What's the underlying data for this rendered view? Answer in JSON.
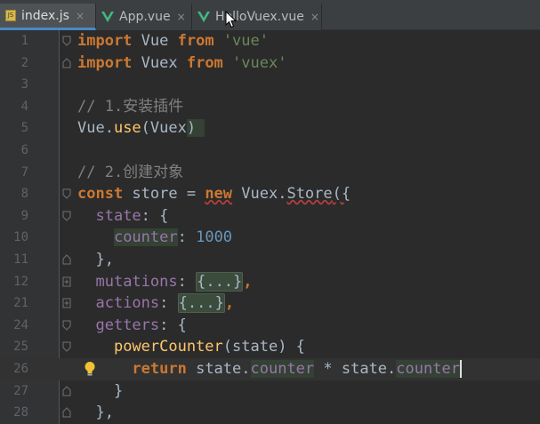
{
  "tabs": [
    {
      "label": "index.js",
      "icon": "js-file-icon",
      "active": true
    },
    {
      "label": "App.vue",
      "icon": "vue-file-icon",
      "active": false
    },
    {
      "label": "HelloVuex.vue",
      "icon": "vue-file-icon",
      "active": false
    }
  ],
  "close_glyph": "×",
  "lines": [
    {
      "n": "1"
    },
    {
      "n": "2"
    },
    {
      "n": "3"
    },
    {
      "n": "4"
    },
    {
      "n": "5"
    },
    {
      "n": "6"
    },
    {
      "n": "7"
    },
    {
      "n": "8"
    },
    {
      "n": "9"
    },
    {
      "n": "10"
    },
    {
      "n": "11"
    },
    {
      "n": "12"
    },
    {
      "n": "21"
    },
    {
      "n": "24"
    },
    {
      "n": "25"
    },
    {
      "n": "26"
    },
    {
      "n": "27"
    },
    {
      "n": "28"
    }
  ],
  "code": {
    "l1": {
      "kw1": "import",
      "id": " Vue ",
      "kw2": "from",
      "sp": " ",
      "str": "'vue'"
    },
    "l2": {
      "kw1": "import",
      "id": " Vuex ",
      "kw2": "from",
      "sp": " ",
      "str": "'vuex'"
    },
    "l4": {
      "comment": "// 1.安装插件"
    },
    "l5": {
      "a": "Vue.",
      "fn": "use",
      "b": "(Vuex",
      "c": ")"
    },
    "l7": {
      "comment": "// 2.创建对象"
    },
    "l8": {
      "kw1": "const",
      "a": " store = ",
      "kw2": "new",
      "b": " Vuex.",
      "cls": "Store",
      "c": "({"
    },
    "l9": {
      "indent": "  ",
      "prop": "state",
      "b": ": {"
    },
    "l10": {
      "indent": "    ",
      "prop": "counter",
      "b": ": ",
      "num": "1000"
    },
    "l11": {
      "text": "  },"
    },
    "l12": {
      "indent": "  ",
      "prop": "mutations",
      "b": ": ",
      "box": "{...}",
      "c": ","
    },
    "l21": {
      "indent": "  ",
      "prop": "actions",
      "b": ": ",
      "box": "{...}",
      "c": ","
    },
    "l24": {
      "indent": "  ",
      "prop": "getters",
      "b": ": {"
    },
    "l25": {
      "indent": "    ",
      "fn": "powerCounter",
      "b": "(state) {"
    },
    "l26": {
      "indent": "      ",
      "kw": "return",
      "a": " state.",
      "p1": "counter",
      "b": " * state.",
      "p2": "counter"
    },
    "l27": {
      "text": "    }"
    },
    "l28": {
      "text": "  },"
    }
  },
  "colors": {
    "background": "#2b2b2b",
    "gutter": "#313335",
    "keyword": "#cc7832",
    "string": "#6a8759",
    "comment": "#808080",
    "number": "#6897bb",
    "property": "#9876aa",
    "function": "#ffc66d",
    "vue_green": "#41b883",
    "active_tab_underline": "#4a88c7"
  }
}
